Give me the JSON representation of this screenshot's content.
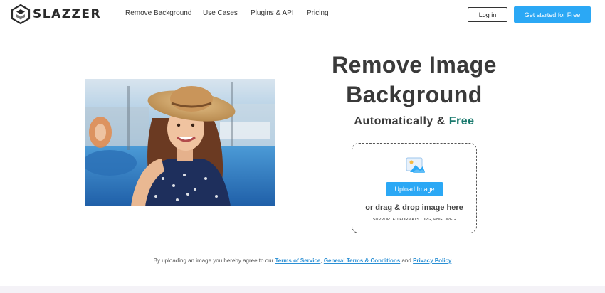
{
  "brand": {
    "name": "SLAZZER"
  },
  "nav": {
    "links": [
      "Remove Background",
      "Use Cases",
      "Plugins & API",
      "Pricing"
    ],
    "login_label": "Log in",
    "cta_label": "Get started for Free"
  },
  "hero": {
    "headline_line1": "Remove Image",
    "headline_line2": "Background",
    "subline_prefix": "Automatically &",
    "subline_highlight": "Free",
    "upload_button": "Upload Image",
    "drag_text": "or drag & drop image here",
    "formats_text": "SUPPORTED FORMATS : JPG, PNG, JPEG"
  },
  "terms": {
    "prefix": "By uploading an image you hereby agree to our",
    "link1": "Terms of Service",
    "sep1": ",",
    "link2": "General Terms & Conditions",
    "sep2": "and",
    "link3": "Privacy Policy"
  },
  "colors": {
    "accent": "#2ba8f5",
    "free_highlight": "#1a7a6e",
    "link": "#2a8fd4",
    "headline": "#3a3a3a"
  }
}
